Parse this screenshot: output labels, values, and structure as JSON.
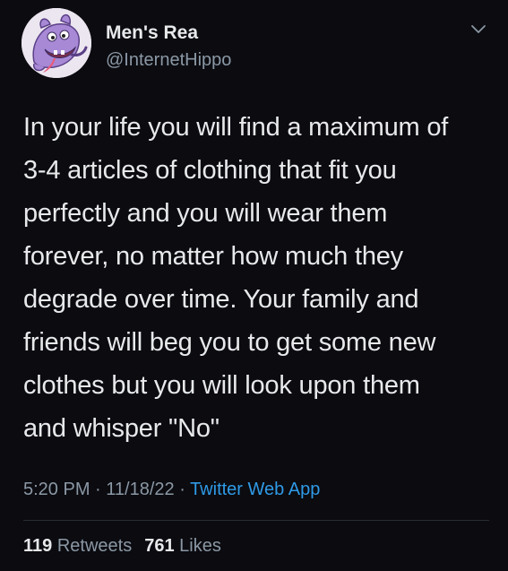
{
  "author": {
    "display_name": "Men's Rea",
    "handle": "@InternetHippo",
    "avatar_icon": "purple-hippo-cartoon-avatar"
  },
  "menu": {
    "icon": "chevron-down-icon"
  },
  "tweet": {
    "text": "In your life you will find a maximum of\n3-4 articles of clothing that fit you\nperfectly and you will wear them\nforever, no matter how much they\ndegrade over time. Your family and\nfriends will beg you to get some new\nclothes but you will look upon them\nand whisper \"No\""
  },
  "meta": {
    "time": "5:20 PM",
    "separator": " · ",
    "date": "11/18/22",
    "source": "Twitter Web App"
  },
  "stats": {
    "retweets_count": "119",
    "retweets_label": "Retweets",
    "likes_count": "761",
    "likes_label": "Likes"
  },
  "colors": {
    "background": "#0b0b10",
    "primary_text": "#e7e9ea",
    "secondary_text": "#8b98a5",
    "link": "#2f9ae6"
  }
}
